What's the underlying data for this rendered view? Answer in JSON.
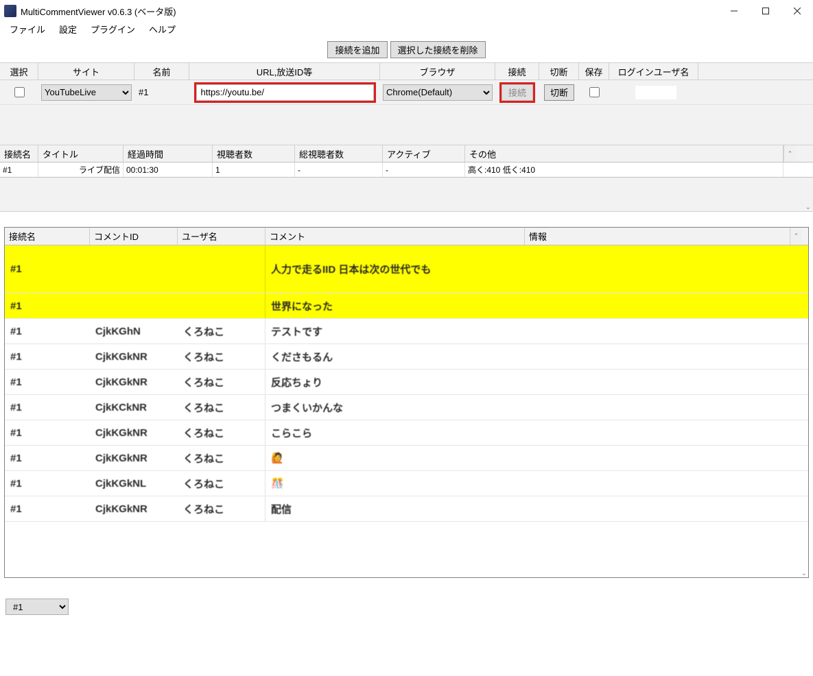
{
  "window": {
    "title": "MultiCommentViewer v0.6.3 (ベータ版)"
  },
  "menu": {
    "file": "ファイル",
    "settings": "設定",
    "plugin": "プラグイン",
    "help": "ヘルプ"
  },
  "toolbar": {
    "add": "接続を追加",
    "remove": "選択した接続を削除"
  },
  "conn_headers": {
    "select": "選択",
    "site": "サイト",
    "name": "名前",
    "url": "URL,放送ID等",
    "browser": "ブラウザ",
    "connect": "接続",
    "disconnect": "切断",
    "save": "保存",
    "login_user": "ログインユーザ名"
  },
  "conn_row": {
    "site": "YouTubeLive",
    "name": "#1",
    "url": "https://youtu.be/",
    "browser": "Chrome(Default)",
    "connect_label": "接続",
    "disconnect_label": "切断"
  },
  "stats_headers": {
    "conn": "接続名",
    "title": "タイトル",
    "elapsed": "経過時間",
    "viewers": "視聴者数",
    "total_viewers": "総視聴者数",
    "active": "アクティブ",
    "other": "その他"
  },
  "stats_row": {
    "conn": "#1",
    "title": "ライブ配信",
    "elapsed": "00:01:30",
    "viewers": "1",
    "total_viewers": "-",
    "active": "-",
    "other": "高く:410 低く:410"
  },
  "comment_headers": {
    "conn": "接続名",
    "cid": "コメントID",
    "user": "ユーザ名",
    "comment": "コメント",
    "info": "情報"
  },
  "comments": [
    {
      "conn": "#1",
      "cid": "",
      "user": "",
      "comment": "人力で走るIID 日本は次の世代でも",
      "highlight": true,
      "tall": true
    },
    {
      "conn": "#1",
      "cid": "",
      "user": "",
      "comment": "世界になった",
      "highlight": true
    },
    {
      "conn": "#1",
      "cid": "CjkKGhN",
      "user": "くろねこ",
      "comment": "テストです",
      "highlight": false
    },
    {
      "conn": "#1",
      "cid": "CjkKGkNR",
      "user": "くろねこ",
      "comment": "くださもるん",
      "highlight": false
    },
    {
      "conn": "#1",
      "cid": "CjkKGkNR",
      "user": "くろねこ",
      "comment": "反応ちょり",
      "highlight": false
    },
    {
      "conn": "#1",
      "cid": "CjkKCkNR",
      "user": "くろねこ",
      "comment": "つまくいかんな",
      "highlight": false
    },
    {
      "conn": "#1",
      "cid": "CjkKGkNR",
      "user": "くろねこ",
      "comment": "こらこら",
      "highlight": false
    },
    {
      "conn": "#1",
      "cid": "CjkKGkNR",
      "user": "くろねこ",
      "comment": "🙋",
      "highlight": false
    },
    {
      "conn": "#1",
      "cid": "CjkKGkNL",
      "user": "くろねこ",
      "comment": "🎊",
      "highlight": false
    },
    {
      "conn": "#1",
      "cid": "CjkKGkNR",
      "user": "くろねこ",
      "comment": "配信",
      "highlight": false
    }
  ],
  "status": {
    "selected": "#1"
  }
}
